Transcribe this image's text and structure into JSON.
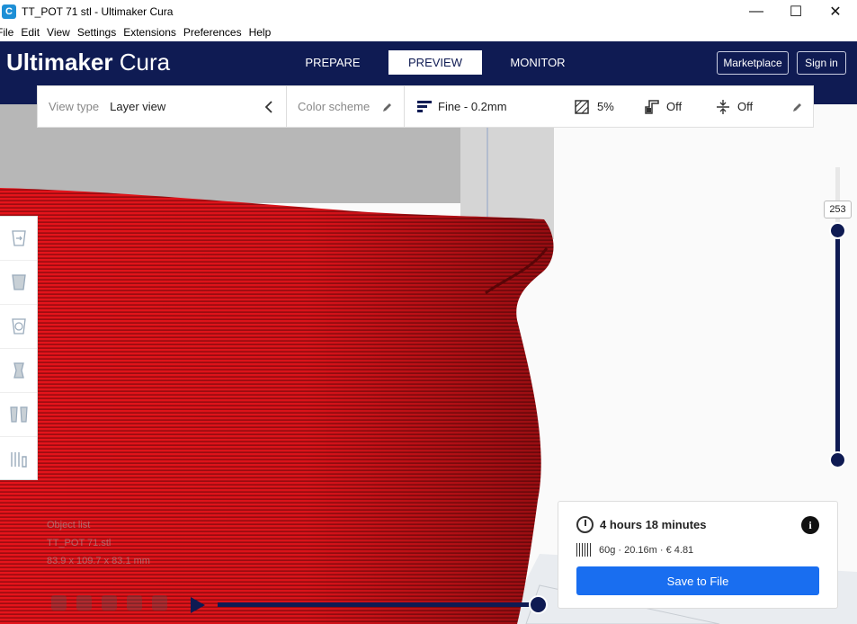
{
  "window": {
    "title": "TT_POT 71 stl - Ultimaker Cura",
    "icon_glyph": "C",
    "minimize_glyph": "—",
    "maximize_glyph": "☐",
    "close_glyph": "✕"
  },
  "menu": [
    "File",
    "Edit",
    "View",
    "Settings",
    "Extensions",
    "Preferences",
    "Help"
  ],
  "header": {
    "logo_bold": "Ultimaker",
    "logo_light": "Cura",
    "tabs": [
      {
        "label": "PREPARE"
      },
      {
        "label": "PREVIEW"
      },
      {
        "label": "MONITOR"
      }
    ],
    "marketplace_label": "Marketplace",
    "signin_label": "Sign in"
  },
  "toolbar": {
    "view_type_label": "View type",
    "view_type_value": "Layer view",
    "color_scheme_label": "Color scheme",
    "profile": "Fine - 0.2mm",
    "infill": "5%",
    "support": "Off",
    "adhesion": "Off"
  },
  "layer_slider": {
    "current_layer": "253"
  },
  "object_list": {
    "label": "Object list",
    "object_name": "TT_POT 71.stl",
    "dimensions": "83.9 x 109.7 x 83.1 mm"
  },
  "print_info": {
    "time": "4 hours 18 minutes",
    "material": "60g · 20.16m · € 4.81",
    "save_label": "Save to File",
    "info_glyph": "i"
  },
  "colors": {
    "header_bg": "#0f1b53",
    "model_red": "#e5141b",
    "save_blue": "#196ef0"
  }
}
